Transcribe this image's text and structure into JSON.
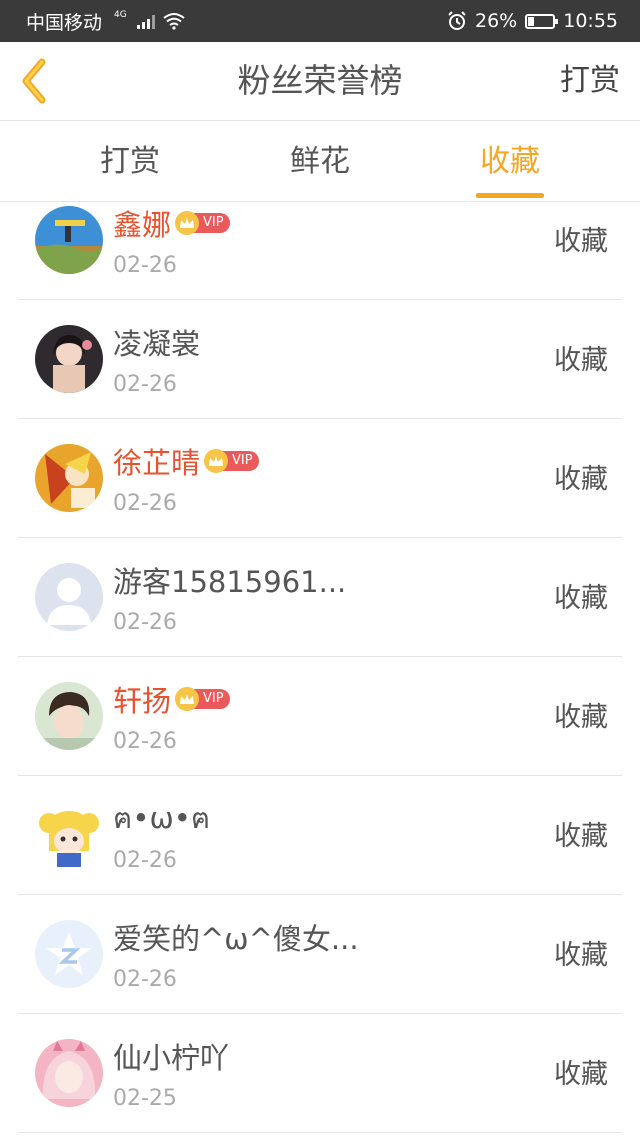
{
  "status_bar": {
    "carrier": "中国移动",
    "network": "4G",
    "battery": "26%",
    "battery_level": 0.26,
    "time": "10:55"
  },
  "nav": {
    "title": "粉丝荣誉榜",
    "action": "打赏"
  },
  "tabs": [
    {
      "label": "打赏",
      "active": false
    },
    {
      "label": "鲜花",
      "active": false
    },
    {
      "label": "收藏",
      "active": true
    }
  ],
  "colors": {
    "accent": "#f5a623",
    "vip_name": "#e8532f",
    "vip_badge": "#ea5a5a",
    "status_bar": "#3a3a3a"
  },
  "fans": [
    {
      "name": "鑫娜",
      "vip": true,
      "vip_label": "VIP",
      "date": "02-26",
      "action": "收藏",
      "avatar": "avatar-landscape-icon"
    },
    {
      "name": "凌凝裳",
      "vip": false,
      "date": "02-26",
      "action": "收藏",
      "avatar": "avatar-girl-icon"
    },
    {
      "name": "徐芷晴",
      "vip": true,
      "vip_label": "VIP",
      "date": "02-26",
      "action": "收藏",
      "avatar": "avatar-anime-icon"
    },
    {
      "name": "游客15815961...",
      "vip": false,
      "date": "02-26",
      "action": "收藏",
      "avatar": "default-user-icon"
    },
    {
      "name": "轩扬",
      "vip": true,
      "vip_label": "VIP",
      "date": "02-26",
      "action": "收藏",
      "avatar": "avatar-boy-icon"
    },
    {
      "name": "ฅ•ω•ฅ",
      "vip": false,
      "date": "02-26",
      "action": "收藏",
      "avatar": "avatar-sailor-icon"
    },
    {
      "name": "爱笑的^ω^傻女...",
      "vip": false,
      "date": "02-26",
      "action": "收藏",
      "avatar": "qq-star-icon"
    },
    {
      "name": "仙小柠吖",
      "vip": false,
      "date": "02-25",
      "action": "收藏",
      "avatar": "avatar-pinkhair-icon"
    }
  ]
}
